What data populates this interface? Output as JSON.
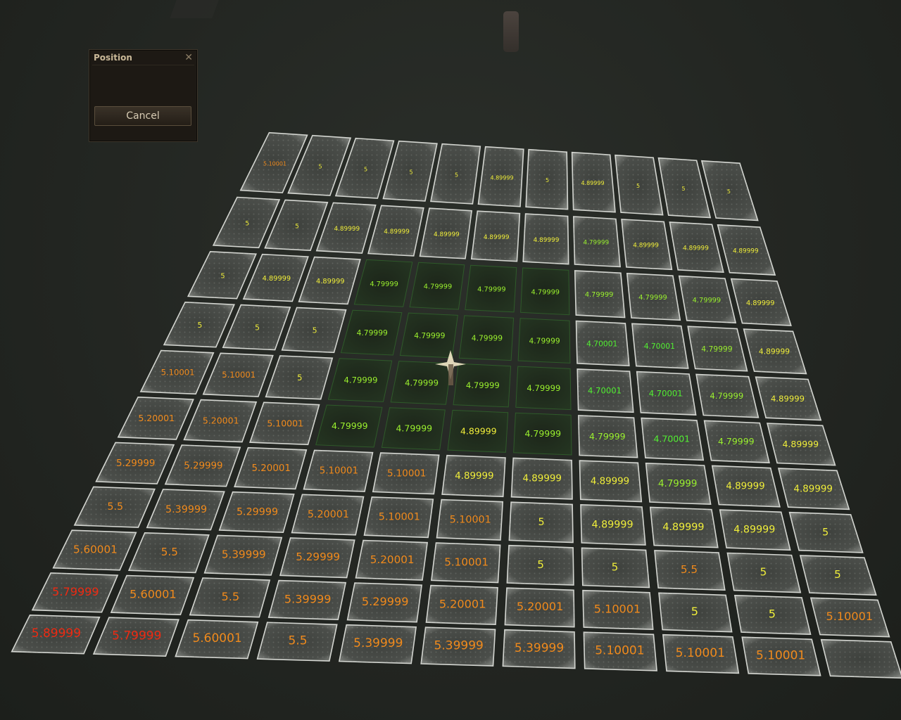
{
  "dialog": {
    "title": "Position",
    "close_icon": "close-icon",
    "cancel_label": "Cancel"
  },
  "colors": {
    "yellow": "#f0ee3a",
    "orange": "#f08a1c",
    "red": "#ee2a12",
    "green": "#52f032"
  },
  "grid": {
    "rows": [
      [
        "5.10001",
        "5",
        "5",
        "5",
        "5",
        "4.89999",
        "5",
        "4.89999",
        "5",
        "5",
        "5"
      ],
      [
        "5",
        "5",
        "4.89999",
        "4.89999",
        "4.89999",
        "4.89999",
        "4.89999",
        "4.79999",
        "4.89999",
        "4.89999",
        "4.89999"
      ],
      [
        "5",
        "4.89999",
        "4.89999",
        "4.79999",
        "4.79999",
        "4.79999",
        "4.79999",
        "4.79999",
        "4.79999",
        "4.79999",
        "4.89999"
      ],
      [
        "5",
        "5",
        "5",
        "4.79999",
        "4.79999",
        "4.79999",
        "4.79999",
        "4.70001",
        "4.70001",
        "4.79999",
        "4.89999"
      ],
      [
        "5.10001",
        "5.10001",
        "5",
        "4.79999",
        "4.79999",
        "4.79999",
        "4.79999",
        "4.70001",
        "4.70001",
        "4.79999",
        "4.89999"
      ],
      [
        "5.20001",
        "5.20001",
        "5.10001",
        "4.79999",
        "4.79999",
        "4.89999",
        "4.79999",
        "4.79999",
        "4.70001",
        "4.79999",
        "4.89999"
      ],
      [
        "5.29999",
        "5.29999",
        "5.20001",
        "5.10001",
        "5.10001",
        "4.89999",
        "4.89999",
        "4.89999",
        "4.79999",
        "4.89999",
        "4.89999"
      ],
      [
        "5.5",
        "5.39999",
        "5.29999",
        "5.20001",
        "5.10001",
        "5.10001",
        "5",
        "4.89999",
        "4.89999",
        "4.89999",
        "5"
      ],
      [
        "5.60001",
        "5.5",
        "5.39999",
        "5.29999",
        "5.20001",
        "5.10001",
        "5",
        "5",
        "5.5",
        "5",
        "5"
      ],
      [
        "5.79999",
        "5.60001",
        "5.5",
        "5.39999",
        "5.29999",
        "5.20001",
        "5.20001",
        "5.10001",
        "5",
        "5",
        "5.10001"
      ],
      [
        "5.89999",
        "5.79999",
        "5.60001",
        "5.5",
        "5.39999",
        "5.39999",
        "5.39999",
        "5.10001",
        "5.10001",
        "5.10001",
        ""
      ]
    ],
    "sunken_tiles": [
      [
        2,
        3
      ],
      [
        2,
        4
      ],
      [
        2,
        5
      ],
      [
        2,
        6
      ],
      [
        3,
        3
      ],
      [
        3,
        4
      ],
      [
        3,
        5
      ],
      [
        3,
        6
      ],
      [
        4,
        3
      ],
      [
        4,
        4
      ],
      [
        4,
        5
      ],
      [
        4,
        6
      ],
      [
        5,
        3
      ],
      [
        5,
        4
      ],
      [
        5,
        5
      ],
      [
        5,
        6
      ]
    ]
  }
}
